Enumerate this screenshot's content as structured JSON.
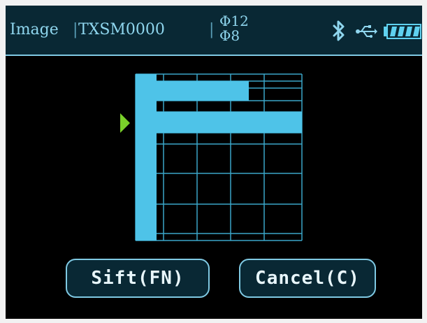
{
  "status_bar": {
    "mode": "Image",
    "separator": "|",
    "file_name": "TXSM0000",
    "diameter_top": "Φ12",
    "diameter_bottom": "Φ8",
    "icons": [
      "bluetooth-icon",
      "usb-icon",
      "battery-icon"
    ],
    "battery_level": 1.0
  },
  "buttons": {
    "sift": "Sift(FN)",
    "cancel": "Cancel(C)"
  },
  "colors": {
    "screen_bg": "#000000",
    "header_bg": "#092834",
    "accent": "#7fc9e3",
    "bar_fill": "#4ec3e8",
    "marker": "#7ad12a",
    "battery": "#5fd2f0"
  }
}
